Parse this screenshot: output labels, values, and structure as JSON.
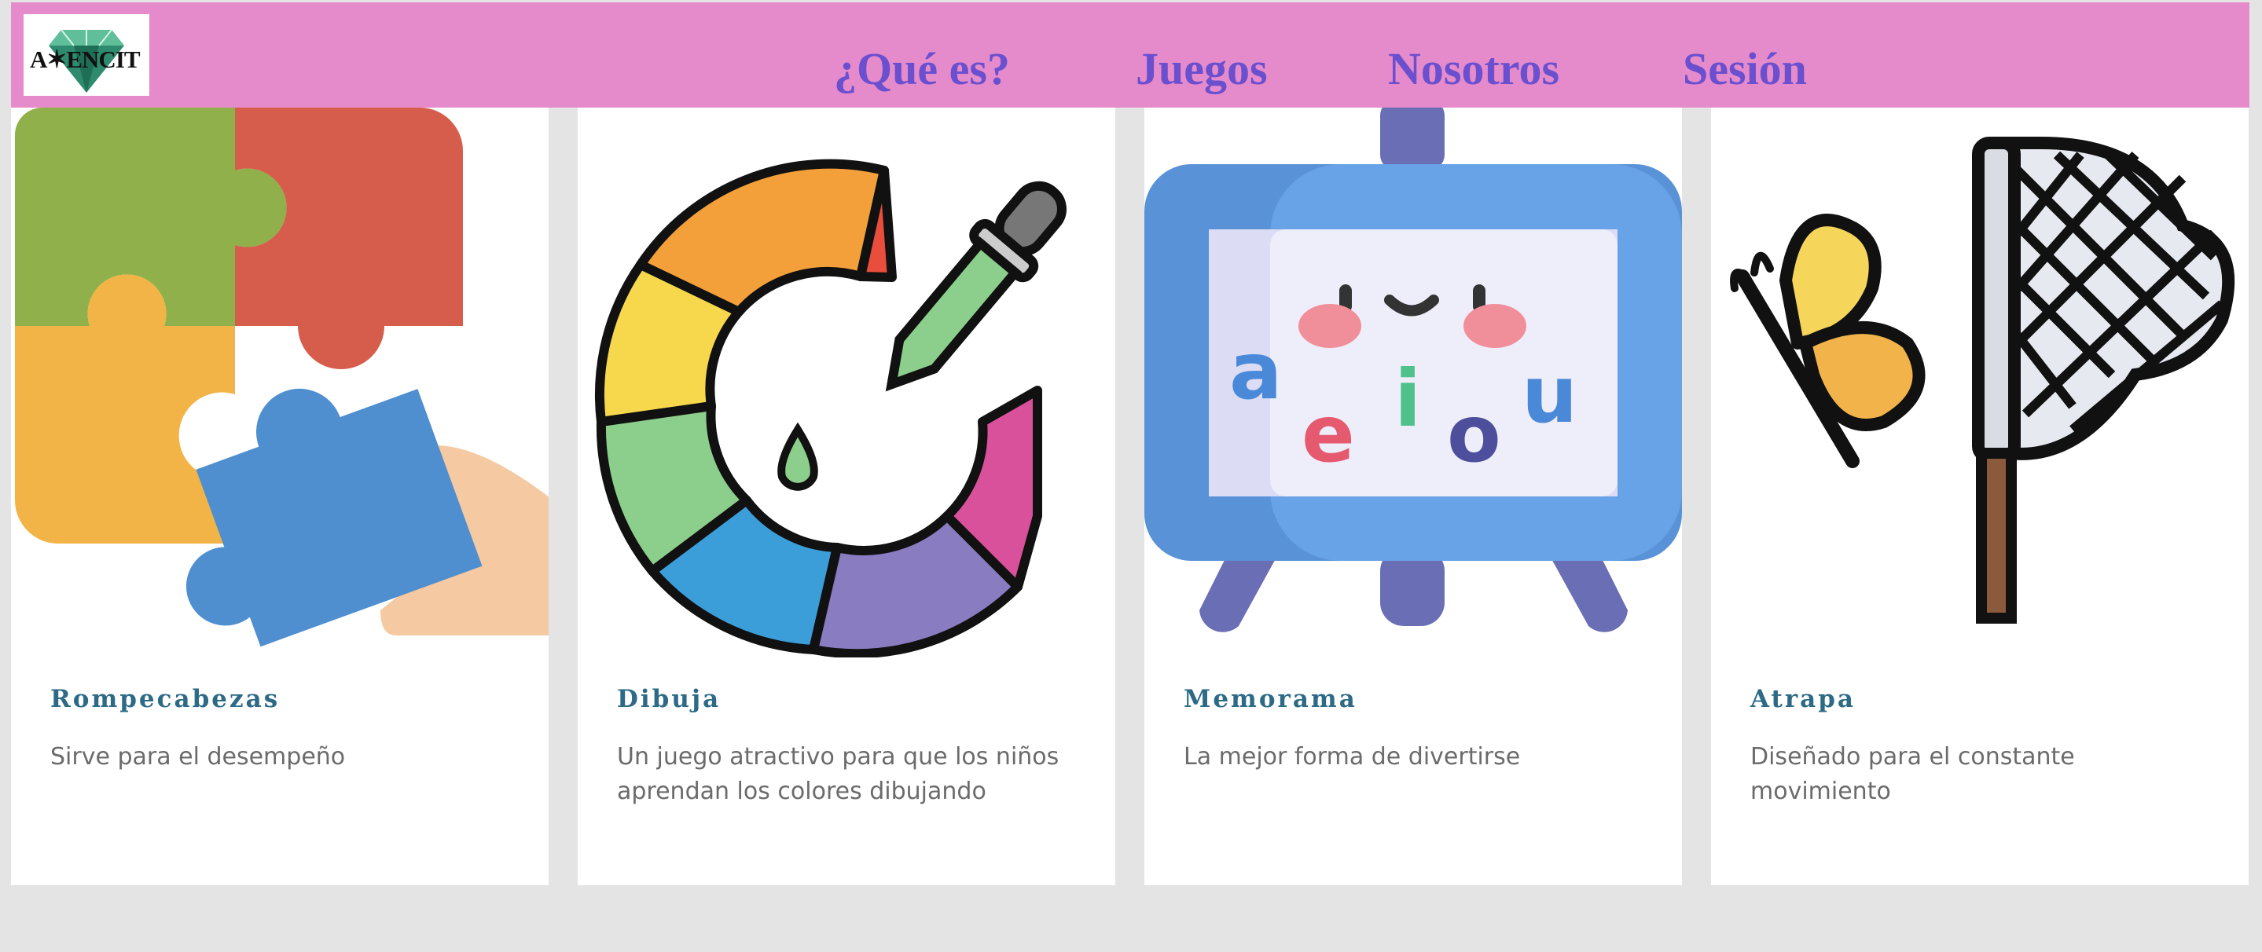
{
  "nav": {
    "logo_text": "A✶ENCIT",
    "links": [
      "¿Qué es?",
      "Juegos",
      "Nosotros",
      "Sesión"
    ]
  },
  "cards": [
    {
      "title": "Rompecabezas",
      "desc": "Sirve para el desempeño",
      "icon": "puzzle-icon"
    },
    {
      "title": "Dibuja",
      "desc": "Un juego atractivo para que los niños aprendan los colores dibujando",
      "icon": "color-wheel-icon"
    },
    {
      "title": "Memorama",
      "desc": "La mejor forma de divertirse",
      "icon": "easel-vowels-icon"
    },
    {
      "title": "Atrapa",
      "desc": "Diseñado para el constante movimiento",
      "icon": "butterfly-net-icon"
    }
  ],
  "easel_letters": [
    "a",
    "e",
    "i",
    "o",
    "u"
  ],
  "colors": {
    "navbar": "#e58bcc",
    "nav_link": "#6a4fcf",
    "card_title": "#2d6a86",
    "card_desc": "#6b6b6b",
    "page_bg": "#e4e4e4"
  }
}
